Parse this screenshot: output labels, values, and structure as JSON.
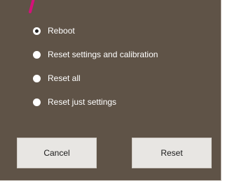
{
  "colors": {
    "dialog_background": "#5f5347",
    "accent_stroke": "#d4117a",
    "text": "#ffffff",
    "button_face": "#e8e6e3"
  },
  "options": [
    {
      "label": "Reboot",
      "selected": true
    },
    {
      "label": "Reset settings and calibration",
      "selected": false
    },
    {
      "label": "Reset all",
      "selected": false
    },
    {
      "label": "Reset just settings",
      "selected": false
    }
  ],
  "buttons": {
    "cancel_label": "Cancel",
    "reset_label": "Reset"
  }
}
